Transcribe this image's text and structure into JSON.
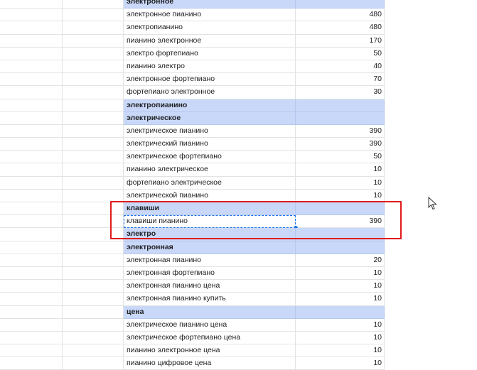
{
  "rows": [
    {
      "type": "header",
      "keyword": "электронное",
      "value": ""
    },
    {
      "type": "data",
      "keyword": "электронное пианино",
      "value": "480"
    },
    {
      "type": "data",
      "keyword": "электропианино",
      "value": "480"
    },
    {
      "type": "data",
      "keyword": "пианино электронное",
      "value": "170"
    },
    {
      "type": "data",
      "keyword": "электро фортепиано",
      "value": "50"
    },
    {
      "type": "data",
      "keyword": "пианино электро",
      "value": "40"
    },
    {
      "type": "data",
      "keyword": "электронное фортепиано",
      "value": "70"
    },
    {
      "type": "data",
      "keyword": "фортепиано электронное",
      "value": "30"
    },
    {
      "type": "header",
      "keyword": "электропианино",
      "value": ""
    },
    {
      "type": "header",
      "keyword": "электрическое",
      "value": ""
    },
    {
      "type": "data",
      "keyword": "электрическое пианино",
      "value": "390"
    },
    {
      "type": "data",
      "keyword": "электрический пианино",
      "value": "390"
    },
    {
      "type": "data",
      "keyword": "электрическое фортепиано",
      "value": "50"
    },
    {
      "type": "data",
      "keyword": "пианино электрическое",
      "value": "10"
    },
    {
      "type": "data",
      "keyword": "фортепиано электрическое",
      "value": "10"
    },
    {
      "type": "data",
      "keyword": "электрической пианино",
      "value": "10"
    },
    {
      "type": "header",
      "keyword": "клавиши",
      "value": ""
    },
    {
      "type": "data",
      "keyword": "клавиши пианино",
      "value": "390",
      "selected": true
    },
    {
      "type": "header",
      "keyword": "электро",
      "value": ""
    },
    {
      "type": "header",
      "keyword": "электронная",
      "value": ""
    },
    {
      "type": "data",
      "keyword": "электронная пианино",
      "value": "20"
    },
    {
      "type": "data",
      "keyword": "электронная фортепиано",
      "value": "10"
    },
    {
      "type": "data",
      "keyword": "электронная пианино цена",
      "value": "10"
    },
    {
      "type": "data",
      "keyword": "электронная пианино купить",
      "value": "10"
    },
    {
      "type": "header",
      "keyword": "цена",
      "value": ""
    },
    {
      "type": "data",
      "keyword": "электрическое пианино цена",
      "value": "10"
    },
    {
      "type": "data",
      "keyword": "электрическое фортепиано цена",
      "value": "10"
    },
    {
      "type": "data",
      "keyword": "пианино электронное цена",
      "value": "10"
    },
    {
      "type": "data",
      "keyword": "пианино цифровое цена",
      "value": "10"
    }
  ],
  "colors": {
    "header_fill": "#c9d8f8",
    "highlight": "#e01b1b",
    "selection": "#1a73e8"
  },
  "icons": {
    "cursor": "mouse-pointer-icon"
  }
}
